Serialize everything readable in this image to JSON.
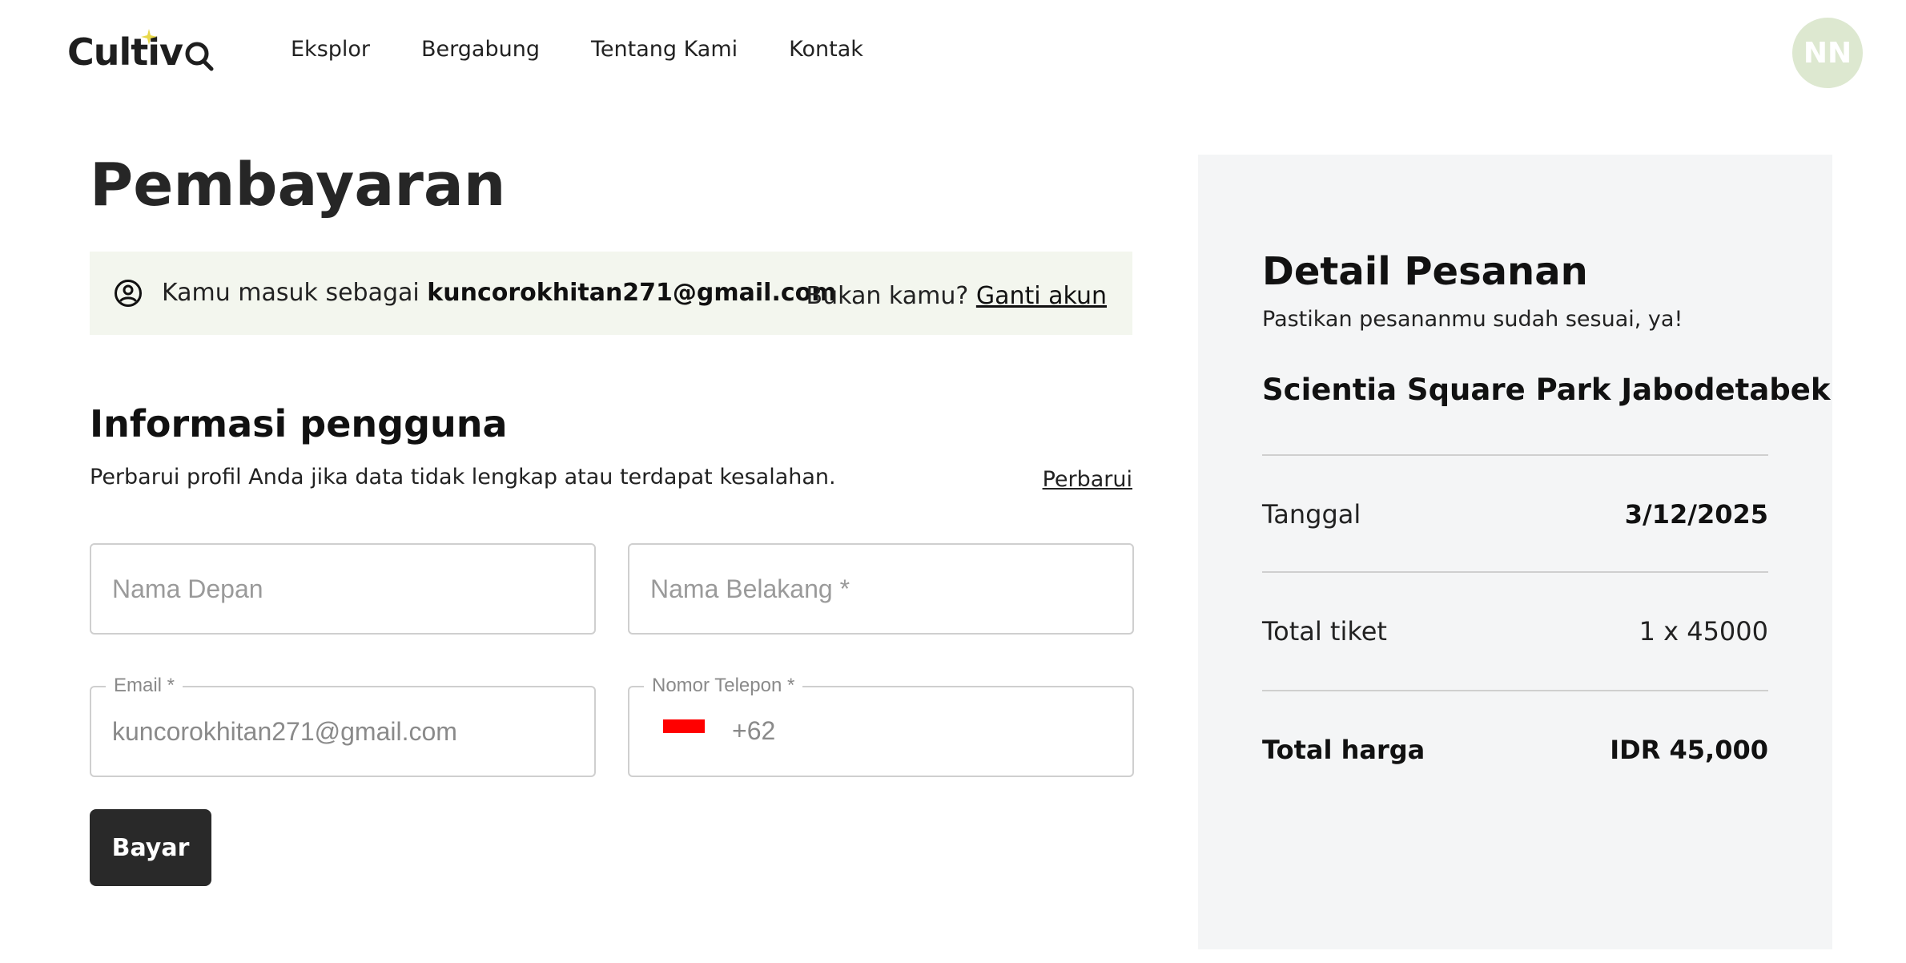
{
  "header": {
    "logo_text": "Cultiv",
    "nav": [
      "Eksplor",
      "Bergabung",
      "Tentang Kami",
      "Kontak"
    ],
    "avatar_initials": "NN"
  },
  "page_title": "Pembayaran",
  "login_banner": {
    "prefix": "Kamu masuk sebagai",
    "email": "kuncorokhitan271@gmail.com",
    "not_you": "Bukan kamu?",
    "switch_link": "Ganti akun"
  },
  "user_info": {
    "title": "Informasi pengguna",
    "subtitle": "Perbarui profil Anda jika data tidak lengkap atau terdapat kesalahan.",
    "update_link": "Perbarui",
    "first_name_placeholder": "Nama Depan",
    "last_name_placeholder": "Nama Belakang *",
    "email_label": "Email *",
    "email_value": "kuncorokhitan271@gmail.com",
    "phone_label": "Nomor Telepon *",
    "phone_code": "+62"
  },
  "pay_button": "Bayar",
  "order": {
    "title": "Detail Pesanan",
    "subtitle": "Pastikan pesananmu sudah sesuai, ya!",
    "event_name": "Scientia Square Park Jabodetabek",
    "date_label": "Tanggal",
    "date_value": "3/12/2025",
    "tickets_label": "Total tiket",
    "tickets_value": "1 x 45000",
    "total_label": "Total harga",
    "total_value": "IDR 45,000"
  },
  "colors": {
    "brand_dark": "#292929",
    "banner_bg": "#f3f6ee",
    "panel_bg": "#f4f5f6",
    "avatar_bg": "#dde8d0",
    "logo_accent": "#e8d84a"
  }
}
